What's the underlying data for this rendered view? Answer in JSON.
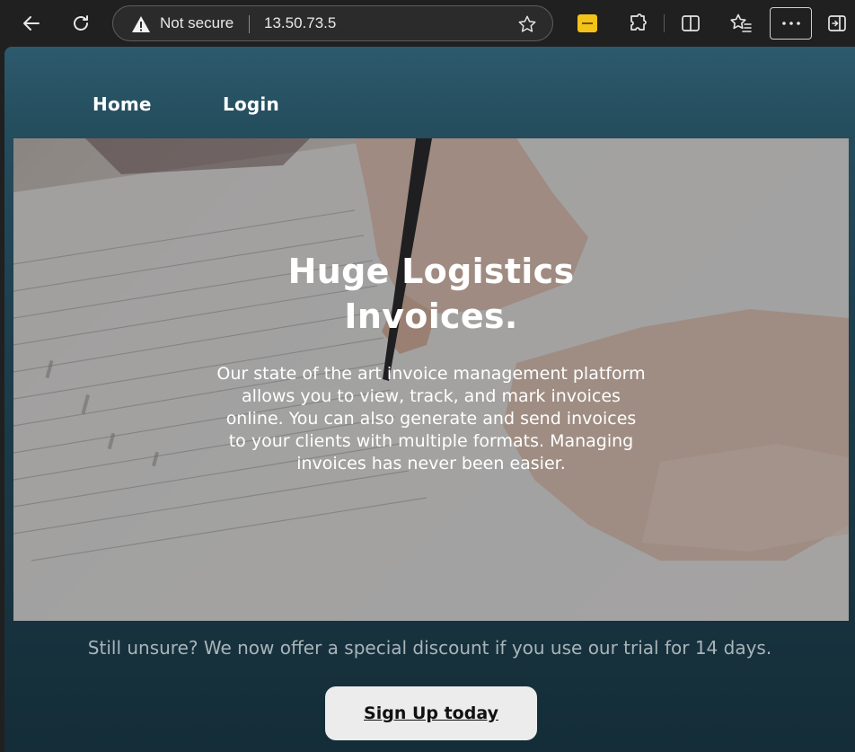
{
  "browser": {
    "security_label": "Not secure",
    "url": "13.50.73.5",
    "icons": [
      "back-arrow-icon",
      "refresh-icon",
      "warning-icon",
      "favorite-star-icon",
      "extension-yellow-icon",
      "extensions-puzzle-icon",
      "split-screen-icon",
      "favorites-icon",
      "more-dots-icon",
      "sidebar-toggle-icon"
    ]
  },
  "nav": {
    "home": "Home",
    "login": "Login"
  },
  "hero": {
    "title": "Huge Logistics Invoices.",
    "description": "Our state of the art invoice management platform allows you to view, track, and mark invoices online. You can also generate and send invoices to your clients with multiple formats. Managing invoices has never been easier."
  },
  "promo": {
    "text": "Still unsure? We now offer a special discount if you use our trial for 14 days."
  },
  "cta": {
    "label": "Sign Up today"
  },
  "colors": {
    "page_gradient_top": "#2c5a6c",
    "page_gradient_bottom": "#142d38",
    "button_bg": "#ececec",
    "promo_text": "#a9b4b8"
  }
}
